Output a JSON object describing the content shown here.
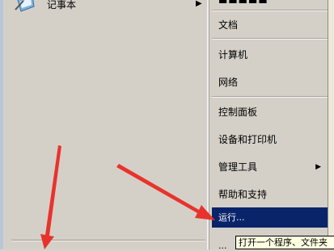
{
  "left_menu": {
    "notepad": {
      "label": "记事本",
      "arrow": "▶"
    }
  },
  "right_menu": {
    "top_cut_label": "▬▬▬▬▬",
    "items": [
      {
        "label": "文档"
      },
      {
        "label": "计算机"
      },
      {
        "label": "网络"
      },
      {
        "label": "控制面板"
      },
      {
        "label": "设备和打印机"
      },
      {
        "label": "管理工具",
        "arrow": "▶"
      },
      {
        "label": "帮助和支持"
      }
    ],
    "run": {
      "label": "运行..."
    },
    "bottom_more": "..."
  },
  "tooltip": {
    "text": "打开一个程序、文件夹"
  },
  "colors": {
    "highlight": "#0a246a",
    "annotation_arrow": "#e8332d",
    "menu_bg": "#d4d0c8"
  }
}
